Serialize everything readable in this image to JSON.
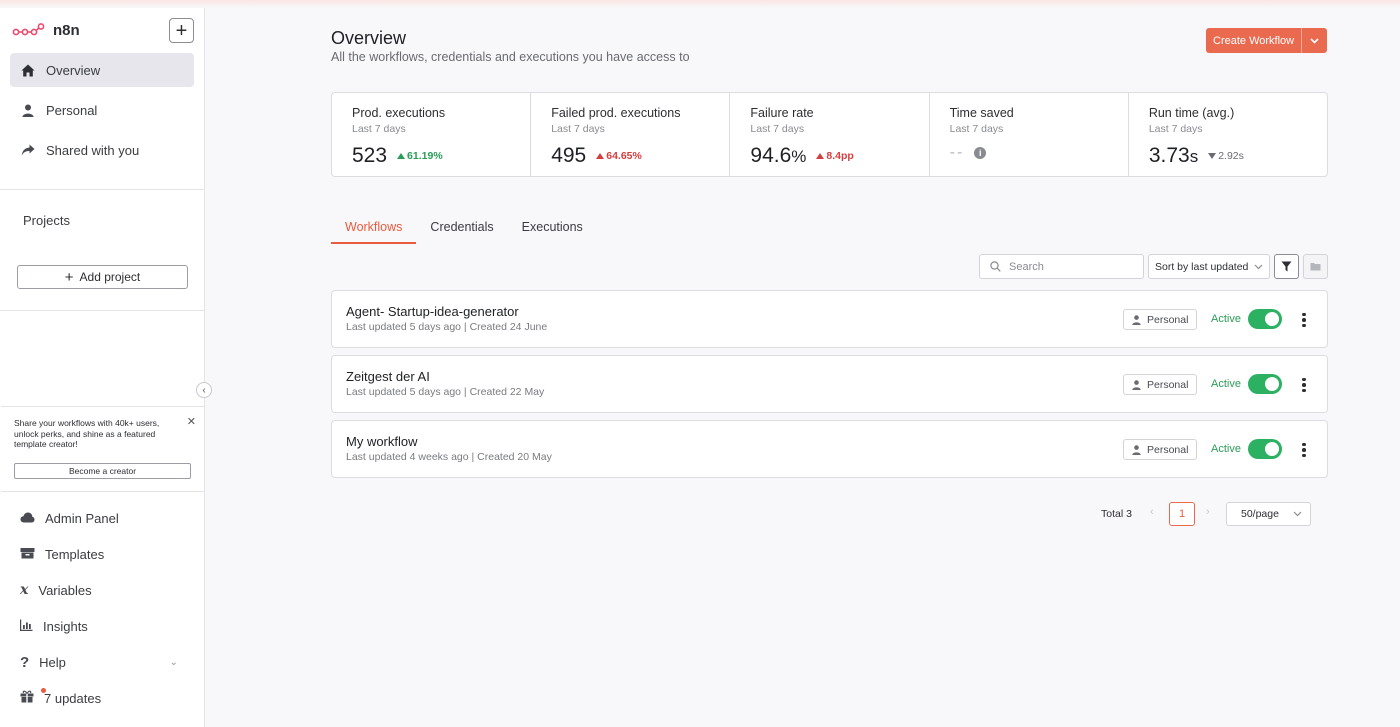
{
  "app": {
    "name": "n8n"
  },
  "sidebar": {
    "nav": [
      {
        "label": "Overview",
        "icon": "home-icon"
      },
      {
        "label": "Personal",
        "icon": "user-icon"
      },
      {
        "label": "Shared with you",
        "icon": "share-icon"
      }
    ],
    "projects_label": "Projects",
    "add_project_label": "Add project",
    "promo": {
      "text": "Share your workflows with 40k+ users, unlock perks, and shine as a featured template creator!",
      "button": "Become a creator"
    },
    "bottom": [
      {
        "label": "Admin Panel",
        "icon": "cloud-icon"
      },
      {
        "label": "Templates",
        "icon": "box-icon"
      },
      {
        "label": "Variables",
        "icon": "variable-icon"
      },
      {
        "label": "Insights",
        "icon": "chart-icon"
      },
      {
        "label": "Help",
        "icon": "question-icon"
      },
      {
        "label": "7 updates",
        "icon": "gift-icon"
      }
    ]
  },
  "header": {
    "title": "Overview",
    "subtitle": "All the workflows, credentials and executions you have access to",
    "create_button": "Create Workflow"
  },
  "stats": [
    {
      "title": "Prod. executions",
      "period": "Last 7 days",
      "value": "523",
      "unit": "",
      "change": "61.19%",
      "direction": "up-green"
    },
    {
      "title": "Failed prod. executions",
      "period": "Last 7 days",
      "value": "495",
      "unit": "",
      "change": "64.65%",
      "direction": "up-red"
    },
    {
      "title": "Failure rate",
      "period": "Last 7 days",
      "value": "94.6",
      "unit": "%",
      "change": "8.4pp",
      "direction": "up-red"
    },
    {
      "title": "Time saved",
      "period": "Last 7 days",
      "value": "--",
      "unit": "",
      "change": "",
      "direction": "none"
    },
    {
      "title": "Run time (avg.)",
      "period": "Last 7 days",
      "value": "3.73",
      "unit": "s",
      "change": "2.92s",
      "direction": "down-gray"
    }
  ],
  "tabs": [
    "Workflows",
    "Credentials",
    "Executions"
  ],
  "toolbar": {
    "search_placeholder": "Search",
    "sort_label": "Sort by last updated"
  },
  "workflows": [
    {
      "name": "Agent- Startup-idea-generator",
      "meta": "Last updated 5 days ago | Created 24 June",
      "owner": "Personal",
      "status": "Active"
    },
    {
      "name": "Zeitgest der AI",
      "meta": "Last updated 5 days ago | Created 22 May",
      "owner": "Personal",
      "status": "Active"
    },
    {
      "name": "My workflow",
      "meta": "Last updated 4 weeks ago | Created 20 May",
      "owner": "Personal",
      "status": "Active"
    }
  ],
  "pagination": {
    "total": "Total 3",
    "page": "1",
    "page_size": "50/page"
  },
  "colors": {
    "accent": "#ea5a3d",
    "active_green": "#2cb062"
  }
}
